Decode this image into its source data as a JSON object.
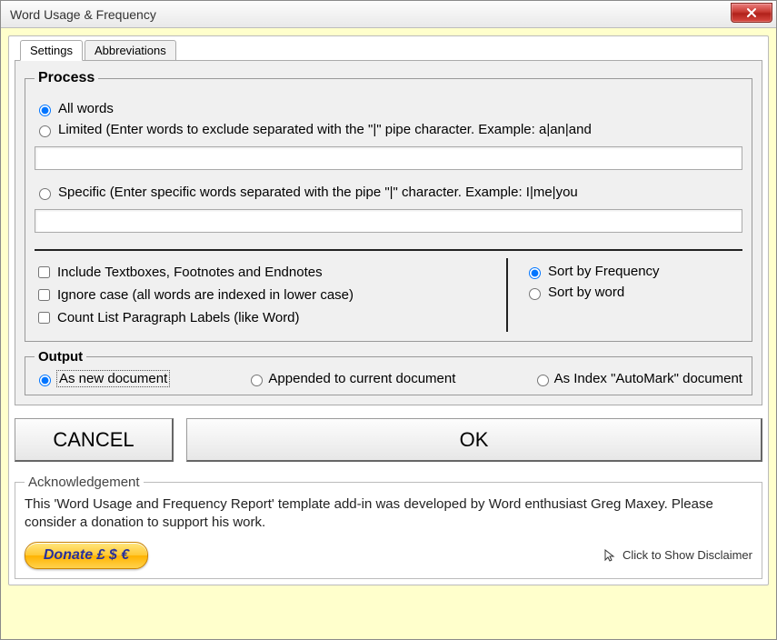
{
  "window": {
    "title": "Word Usage & Frequency"
  },
  "tabs": {
    "settings": "Settings",
    "abbreviations": "Abbreviations"
  },
  "process": {
    "legend": "Process",
    "allWords": "All words",
    "limited": "Limited (Enter words to exclude separated with the \"|\" pipe character.  Example: a|an|and",
    "limitedValue": "",
    "specific": "Specific (Enter specific words separated with the pipe \"|\" character.  Example: I|me|you",
    "specificValue": "",
    "includeTextboxes": "Include Textboxes, Footnotes and Endnotes",
    "ignoreCase": "Ignore case (all words are indexed in lower case)",
    "countLabels": "Count List Paragraph Labels (like Word)",
    "sortByFrequency": "Sort by Frequency",
    "sortByWord": "Sort by word"
  },
  "output": {
    "legend": "Output",
    "newDoc": "As new document",
    "appended": "Appended to current document",
    "automark": "As Index \"AutoMark\" document"
  },
  "buttons": {
    "cancel": "CANCEL",
    "ok": "OK"
  },
  "ack": {
    "legend": "Acknowledgement",
    "text": "This 'Word Usage and Frequency Report' template add-in was developed by Word enthusiast Greg Maxey.  Please consider a donation to support his work.",
    "donate": "Donate £ $ €",
    "disclaimer": "Click to Show Disclaimer"
  }
}
